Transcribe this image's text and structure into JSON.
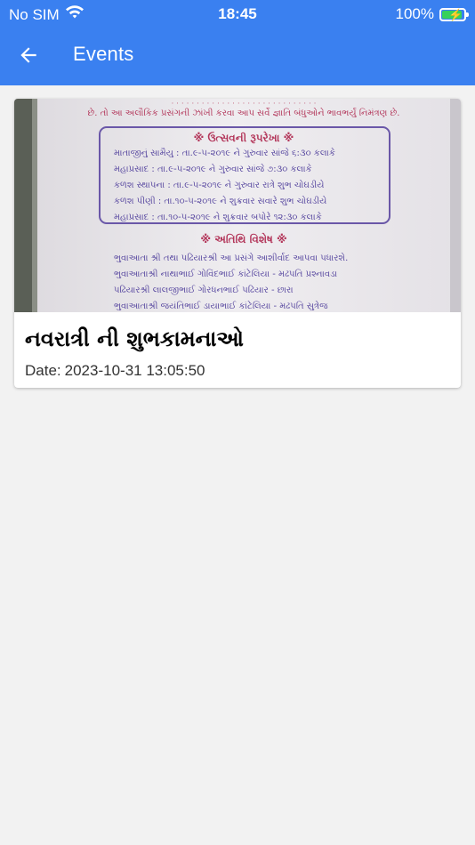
{
  "status_bar": {
    "carrier": "No SIM",
    "time": "18:45",
    "battery_percent": "100%",
    "battery_level": 1.0,
    "wifi_icon": "wifi-icon",
    "battery_icon": "battery-charging-icon"
  },
  "app_bar": {
    "title": "Events",
    "back_icon": "arrow-left-icon"
  },
  "events": [
    {
      "title": "નવરાત્રી ની શુભકામનાઓ",
      "date_label": "Date:",
      "date_value": "2023-10-31 13:05:50",
      "image": {
        "type": "poster-photo",
        "section_heading": "ઉત્સવની રૂપરેખા",
        "schedule_lines": [
          "માતાજીનું સામૈયુ : તા.૯-૫-૨૦૧૯ ને ગુરુવાર સાંજે ૬:૩૦ કલાકે",
          "મહાપ્રસાદ : તા.૯-૫-૨૦૧૯ ને ગુરુવાર સાંજે ૭:૩૦ કલાકે",
          "કળશ સ્થાપના : તા.૯-૫-૨૦૧૯ ને ગુરુવાર રાત્રે શુભ ચોઘડીયે",
          "કળશ પીણી : તા.૧૦-૫-૨૦૧૯ ને શુક્રવાર સવારે શુભ ચોઘડીયે",
          "મહાપ્રસાદ : તા.૧૦-૫-૨૦૧૯ ને શુક્રવાર બપોરે ૧૨:૩૦ કલાકે"
        ],
        "guest_heading": "અતિથિ વિશેષ",
        "guest_lines": [
          "ભુવાઆતા શ્રી તથા પઢિયારશ્રી આ પ્રસંગે આશીર્વાદ આપવા પધારશે.",
          "ભુવાઆતાશ્રી નાથાભાઈ ગોવિંદભાઈ કાંટેલિયા - મઢપતિ પ્રશ્નાવડા",
          "પઢિયારશ્રી લાલજીભાઈ ગોરધનભાઈ પઢિયાર - છારા",
          "ભુવાઆતાશ્રી જયંતિભાઈ ડાયાભાઈ કાંટેલિયા - મઢપતિ સુત્રેજ"
        ],
        "top_line": "છે. તો આ અલૌકિક પ્રસંગની ઝાંખી કરવા આપ સર્વે જ્ઞાતિ બંધુઓને ભાવભર્યું નિમંત્રણ છે."
      }
    }
  ]
}
